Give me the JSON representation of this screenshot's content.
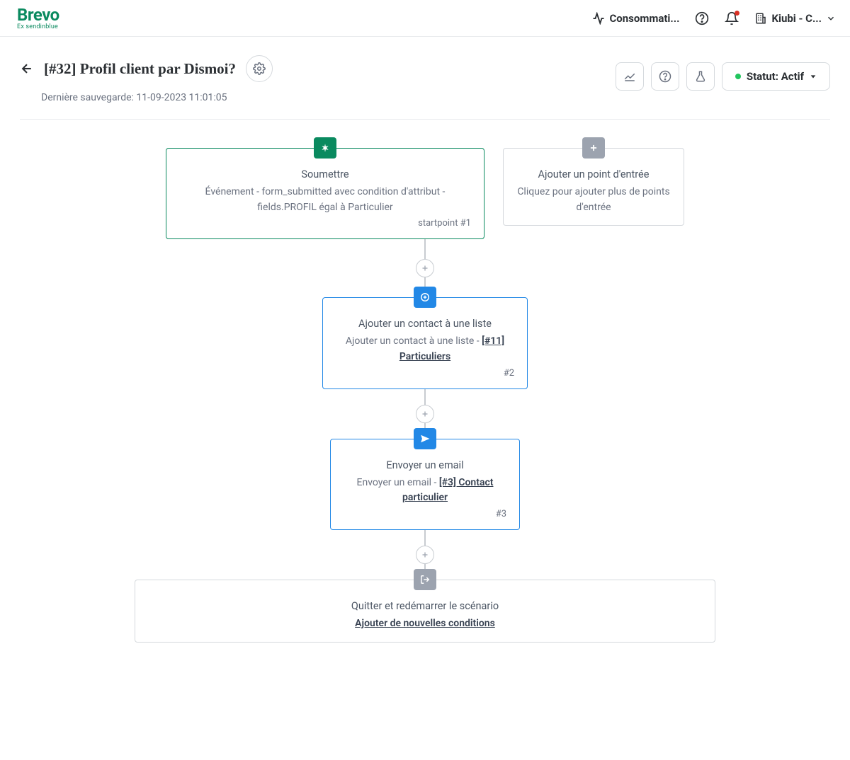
{
  "topbar": {
    "logo": "Brevo",
    "logo_sub": "Ex sendinblue",
    "consumption": "Consommati...",
    "account": "Kiubi - C..."
  },
  "header": {
    "title": "[#32] Profil client par Dismoi?",
    "last_save": "Dernière sauvegarde: 11-09-2023 11:01:05",
    "status_label": "Statut: Actif"
  },
  "workflow": {
    "entry": {
      "title": "Soumettre",
      "desc": "Événement - form_submitted avec condition d'attribut - fields.PROFIL égal à Particulier",
      "meta": "startpoint #1"
    },
    "add_entry": {
      "title": "Ajouter un point d'entrée",
      "desc": "Cliquez pour ajouter plus de points d'entrée"
    },
    "step2": {
      "title": "Ajouter un contact à une liste",
      "desc_prefix": "Ajouter un contact à une liste - ",
      "desc_link": "[#11] Particuliers",
      "meta": "#2"
    },
    "step3": {
      "title": "Envoyer un email",
      "desc_prefix": "Envoyer un email - ",
      "desc_link": "[#3] Contact particulier",
      "meta": "#3"
    },
    "exit": {
      "title": "Quitter et redémarrer le scénario",
      "link": "Ajouter de nouvelles conditions"
    }
  }
}
